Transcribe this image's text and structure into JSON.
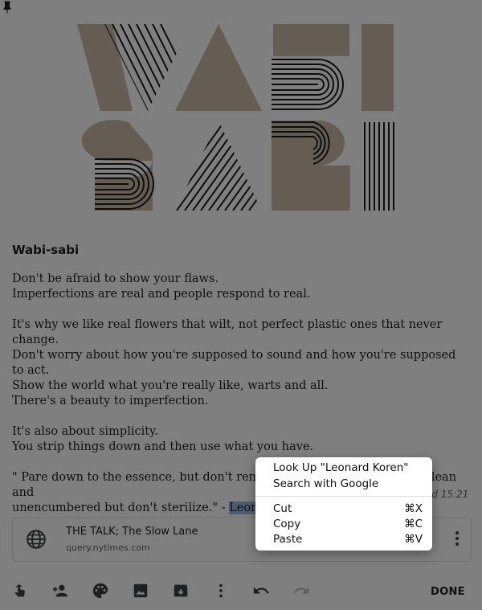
{
  "hero": {
    "art_text": "WABI SABI",
    "colors": {
      "tan": "#cbb8a9",
      "line": "#1a1a1a"
    }
  },
  "note": {
    "title": "Wabi-sabi",
    "lines": [
      "Don't be afraid to show your flaws.",
      "Imperfections are real and people respond to real.",
      "",
      "It's why we like real flowers that wilt, not perfect plastic ones that never change.",
      "Don't worry about how you're supposed to sound and how you're supposed to act.",
      "Show the world what you're really like, warts and all.",
      "There's a beauty to imperfection.",
      "",
      "It's also about simplicity.",
      "You strip things down and then use what you have.",
      "",
      "\" Pare down to the essence, but don't remove the poetry. Keep things clean and"
    ],
    "last_line_prefix": "unencumbered but don't sterilize.\" - ",
    "selected_text": "Leonard K",
    "edited": "ed 15:21"
  },
  "link_card": {
    "title": "THE TALK; The Slow Lane",
    "url": "query.nytimes.com"
  },
  "toolbar": {
    "done_label": "DONE"
  },
  "context_menu": {
    "items": [
      {
        "label": "Look Up \"Leonard Koren\"",
        "shortcut": ""
      },
      {
        "label": "Search with Google",
        "shortcut": ""
      },
      {
        "label": "Cut",
        "shortcut": "⌘X"
      },
      {
        "label": "Copy",
        "shortcut": "⌘C"
      },
      {
        "label": "Paste",
        "shortcut": "⌘V"
      }
    ]
  }
}
